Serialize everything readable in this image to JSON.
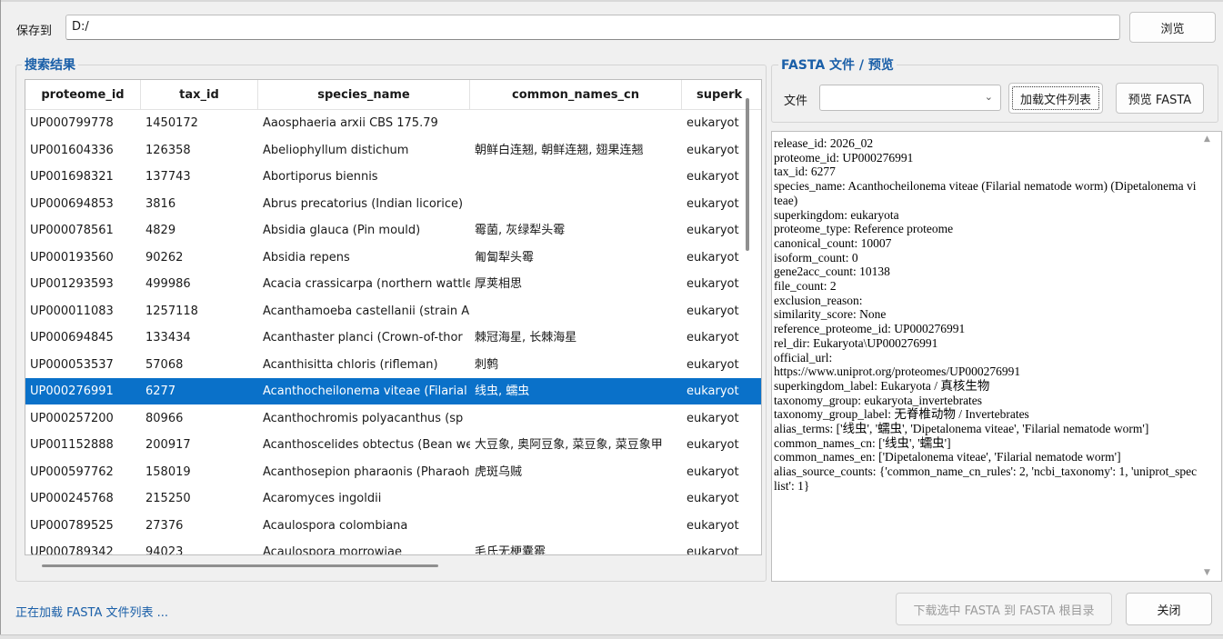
{
  "save": {
    "label": "保存到",
    "path": "D:/",
    "browse_label": "浏览"
  },
  "results": {
    "title": "搜索结果",
    "columns": [
      "proteome_id",
      "tax_id",
      "species_name",
      "common_names_cn",
      "superk"
    ],
    "rows": [
      [
        "UP000799778",
        "1450172",
        "Aaosphaeria arxii CBS 175.79",
        "",
        "eukaryot"
      ],
      [
        "UP001604336",
        "126358",
        "Abeliophyllum distichum",
        "朝鲜白连翘, 朝鲜连翘, 翅果连翘",
        "eukaryot"
      ],
      [
        "UP001698321",
        "137743",
        "Abortiporus biennis",
        "",
        "eukaryot"
      ],
      [
        "UP000694853",
        "3816",
        "Abrus precatorius (Indian licorice)",
        "",
        "eukaryot"
      ],
      [
        "UP000078561",
        "4829",
        "Absidia glauca (Pin mould)",
        "霉菌, 灰绿犁头霉",
        "eukaryot"
      ],
      [
        "UP000193560",
        "90262",
        "Absidia repens",
        "匍匐犁头霉",
        "eukaryot"
      ],
      [
        "UP001293593",
        "499986",
        "Acacia crassicarpa (northern wattle",
        "厚荚相思",
        "eukaryot"
      ],
      [
        "UP000011083",
        "1257118",
        "Acanthamoeba castellanii (strain A",
        "",
        "eukaryot"
      ],
      [
        "UP000694845",
        "133434",
        "Acanthaster planci (Crown-of-thor",
        "棘冠海星, 长棘海星",
        "eukaryot"
      ],
      [
        "UP000053537",
        "57068",
        "Acanthisitta chloris (rifleman)",
        "刺鹩",
        "eukaryot"
      ],
      [
        "UP000276991",
        "6277",
        "Acanthocheilonema viteae (Filarial",
        "线虫, 蠕虫",
        "eukaryot"
      ],
      [
        "UP000257200",
        "80966",
        "Acanthochromis polyacanthus (sp",
        "",
        "eukaryot"
      ],
      [
        "UP001152888",
        "200917",
        "Acanthoscelides obtectus (Bean we",
        "大豆象, 奥阿豆象, 菜豆象, 菜豆象甲",
        "eukaryot"
      ],
      [
        "UP000597762",
        "158019",
        "Acanthosepion pharaonis (Pharaoh",
        "虎斑乌贼",
        "eukaryot"
      ],
      [
        "UP000245768",
        "215250",
        "Acaromyces ingoldii",
        "",
        "eukaryot"
      ],
      [
        "UP000789525",
        "27376",
        "Acaulospora colombiana",
        "",
        "eukaryot"
      ],
      [
        "UP000789342",
        "94023",
        "Acaulospora morrowiae",
        "毛氏无梗囊霉",
        "eukaryot"
      ]
    ],
    "selected_index": 10
  },
  "fasta": {
    "title": "FASTA 文件 / 预览",
    "file_label": "文件",
    "file_value": "",
    "load_list_label": "加载文件列表",
    "preview_label": "预览 FASTA",
    "preview_text": "release_id: 2026_02\nproteome_id: UP000276991\ntax_id: 6277\nspecies_name: Acanthocheilonema viteae (Filarial nematode worm) (Dipetalonema viteae)\nsuperkingdom: eukaryota\nproteome_type: Reference proteome\ncanonical_count: 10007\nisoform_count: 0\ngene2acc_count: 10138\nfile_count: 2\nexclusion_reason:\nsimilarity_score: None\nreference_proteome_id: UP000276991\nrel_dir: Eukaryota\\UP000276991\nofficial_url:\nhttps://www.uniprot.org/proteomes/UP000276991\nsuperkingdom_label: Eukaryota / 真核生物\ntaxonomy_group: eukaryota_invertebrates\ntaxonomy_group_label: 无脊椎动物 / Invertebrates\nalias_terms: ['线虫', '蠕虫', 'Dipetalonema viteae', 'Filarial nematode worm']\ncommon_names_cn: ['线虫', '蠕虫']\ncommon_names_en: ['Dipetalonema viteae', 'Filarial nematode worm']\nalias_source_counts: {'common_name_cn_rules': 2, 'ncbi_taxonomy': 1, 'uniprot_speclist': 1}"
  },
  "footer": {
    "status": "正在加载 FASTA 文件列表 ...",
    "download_label": "下载选中 FASTA 到 FASTA 根目录",
    "close_label": "关闭"
  },
  "colors": {
    "accent": "#1a5fa8",
    "selection": "#0a71c9"
  },
  "icons": {
    "combo": "chevron-down-icon",
    "scroll_up": "scroll-up-arrow-icon",
    "scroll_down": "scroll-down-arrow-icon"
  }
}
